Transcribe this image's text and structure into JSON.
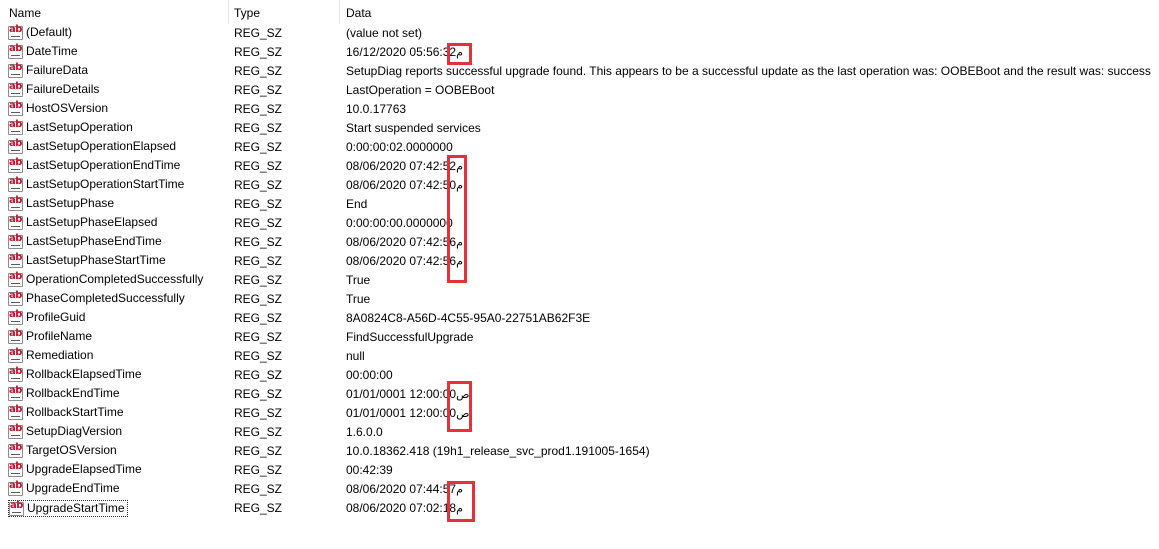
{
  "columns": {
    "name": "Name",
    "type": "Type",
    "data": "Data"
  },
  "icon": "string-value-ab-icon",
  "icon_text": "ab",
  "rows": [
    {
      "name": "(Default)",
      "type": "REG_SZ",
      "data": "(value not set)",
      "suffix": ""
    },
    {
      "name": "DateTime",
      "type": "REG_SZ",
      "data": "16/12/2020 05:56:32",
      "suffix": "م"
    },
    {
      "name": "FailureData",
      "type": "REG_SZ",
      "data": "SetupDiag reports successful upgrade found. This appears to be a successful update as the last operation was: OOBEBoot and the result was: success",
      "suffix": ""
    },
    {
      "name": "FailureDetails",
      "type": "REG_SZ",
      "data": "LastOperation = OOBEBoot",
      "suffix": ""
    },
    {
      "name": "HostOSVersion",
      "type": "REG_SZ",
      "data": "10.0.17763",
      "suffix": ""
    },
    {
      "name": "LastSetupOperation",
      "type": "REG_SZ",
      "data": "Start suspended services",
      "suffix": ""
    },
    {
      "name": "LastSetupOperationElapsed",
      "type": "REG_SZ",
      "data": "0:00:00:02.0000000",
      "suffix": ""
    },
    {
      "name": "LastSetupOperationEndTime",
      "type": "REG_SZ",
      "data": "08/06/2020 07:42:52",
      "suffix": "م"
    },
    {
      "name": "LastSetupOperationStartTime",
      "type": "REG_SZ",
      "data": "08/06/2020 07:42:50",
      "suffix": "م"
    },
    {
      "name": "LastSetupPhase",
      "type": "REG_SZ",
      "data": "End",
      "suffix": ""
    },
    {
      "name": "LastSetupPhaseElapsed",
      "type": "REG_SZ",
      "data": "0:00:00:00.0000000",
      "suffix": ""
    },
    {
      "name": "LastSetupPhaseEndTime",
      "type": "REG_SZ",
      "data": "08/06/2020 07:42:56",
      "suffix": "م"
    },
    {
      "name": "LastSetupPhaseStartTime",
      "type": "REG_SZ",
      "data": "08/06/2020 07:42:56",
      "suffix": "م"
    },
    {
      "name": "OperationCompletedSuccessfully",
      "type": "REG_SZ",
      "data": "True",
      "suffix": ""
    },
    {
      "name": "PhaseCompletedSuccessfully",
      "type": "REG_SZ",
      "data": "True",
      "suffix": ""
    },
    {
      "name": "ProfileGuid",
      "type": "REG_SZ",
      "data": "8A0824C8-A56D-4C55-95A0-22751AB62F3E",
      "suffix": ""
    },
    {
      "name": "ProfileName",
      "type": "REG_SZ",
      "data": "FindSuccessfulUpgrade",
      "suffix": ""
    },
    {
      "name": "Remediation",
      "type": "REG_SZ",
      "data": "null",
      "suffix": ""
    },
    {
      "name": "RollbackElapsedTime",
      "type": "REG_SZ",
      "data": "00:00:00",
      "suffix": ""
    },
    {
      "name": "RollbackEndTime",
      "type": "REG_SZ",
      "data": "01/01/0001 12:00:00",
      "suffix": "ص"
    },
    {
      "name": "RollbackStartTime",
      "type": "REG_SZ",
      "data": "01/01/0001 12:00:00",
      "suffix": "ص"
    },
    {
      "name": "SetupDiagVersion",
      "type": "REG_SZ",
      "data": "1.6.0.0",
      "suffix": ""
    },
    {
      "name": "TargetOSVersion",
      "type": "REG_SZ",
      "data": "10.0.18362.418 (19h1_release_svc_prod1.191005-1654)",
      "suffix": ""
    },
    {
      "name": "UpgradeElapsedTime",
      "type": "REG_SZ",
      "data": "00:42:39",
      "suffix": ""
    },
    {
      "name": "UpgradeEndTime",
      "type": "REG_SZ",
      "data": "08/06/2020 07:44:57",
      "suffix": "م"
    },
    {
      "name": "UpgradeStartTime",
      "type": "REG_SZ",
      "data": "08/06/2020 07:02:18",
      "suffix": "م"
    }
  ],
  "selected_row": "UpgradeStartTime",
  "colors": {
    "highlight": "#e8303a",
    "icon_text": "#c8102e",
    "text": "#000000",
    "background": "#ffffff"
  }
}
